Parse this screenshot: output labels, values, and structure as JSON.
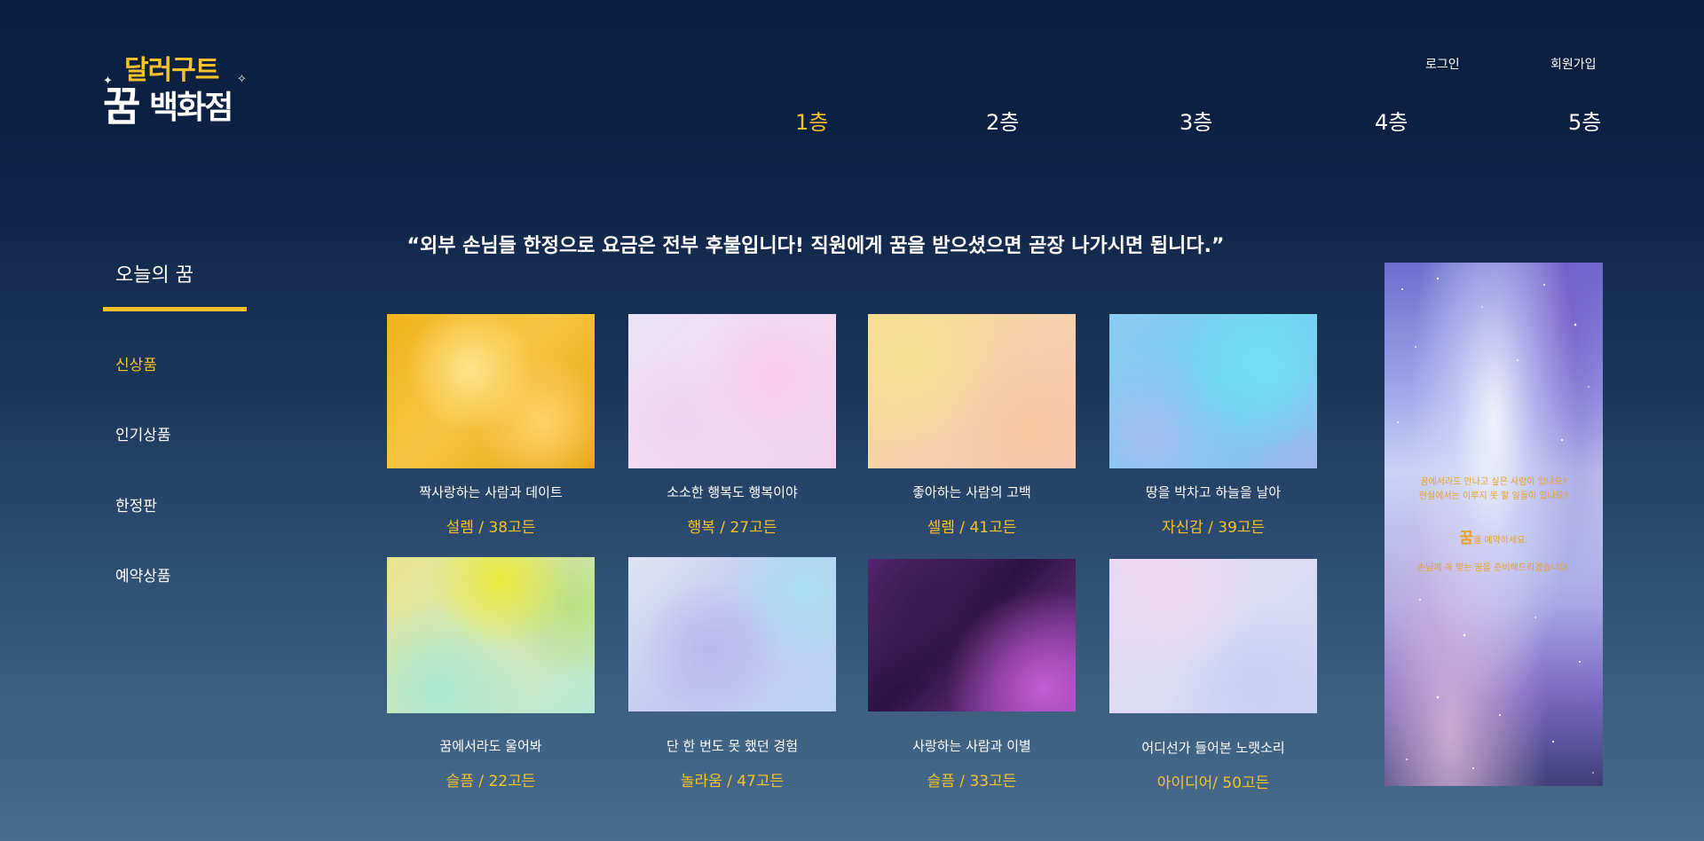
{
  "logo": {
    "line1": "달러구트",
    "line2a": "꿈",
    "line2b": "백화점"
  },
  "util": {
    "login": "로그인",
    "join": "회원가입"
  },
  "floors": [
    "1층",
    "2층",
    "3층",
    "4층",
    "5층"
  ],
  "notice": "“외부 손님들 한정으로 요금은 전부 후불입니다! 직원에게 꿈을 받으셨으면 곧장 나가시면 됩니다.”",
  "sidebar": {
    "title": "오늘의 꿈",
    "items": [
      "신상품",
      "인기상품",
      "한정판",
      "예약상품"
    ]
  },
  "products": [
    {
      "title": "짝사랑하는 사람과 데이트",
      "price": "설렘 / 38고든"
    },
    {
      "title": "소소한 행복도 행복이야",
      "price": "행복 / 27고든"
    },
    {
      "title": "좋아하는 사람의 고백",
      "price": "셀렘 / 41고든"
    },
    {
      "title": "땅을 박차고 하늘을 날아",
      "price": "자신감 / 39고든"
    },
    {
      "title": "꿈에서라도 울어봐",
      "price": "슬픔 / 22고든"
    },
    {
      "title": "단 한 번도 못 했던 경험",
      "price": "놀라움 / 47고든"
    },
    {
      "title": "사랑하는 사람과 이별",
      "price": "슬픔 / 33고든"
    },
    {
      "title": "어디선가 들어본 노랫소리",
      "price": "아이디어/ 50고든"
    }
  ],
  "banner": {
    "line1": "꿈에서라도 만나고 싶은 사람이 있나요?",
    "line2": "현실에서는 이루지 못 할 일들이 있나요?",
    "big": "꿈",
    "line3": "을 예약하세요.",
    "line4": "손님께 꼭 맞는 꿈을 준비해드리겠습니다."
  },
  "colors": {
    "accent": "#f5c22a",
    "bg_top": "#0b1f3e",
    "bg_bottom": "#4a6c8b"
  }
}
